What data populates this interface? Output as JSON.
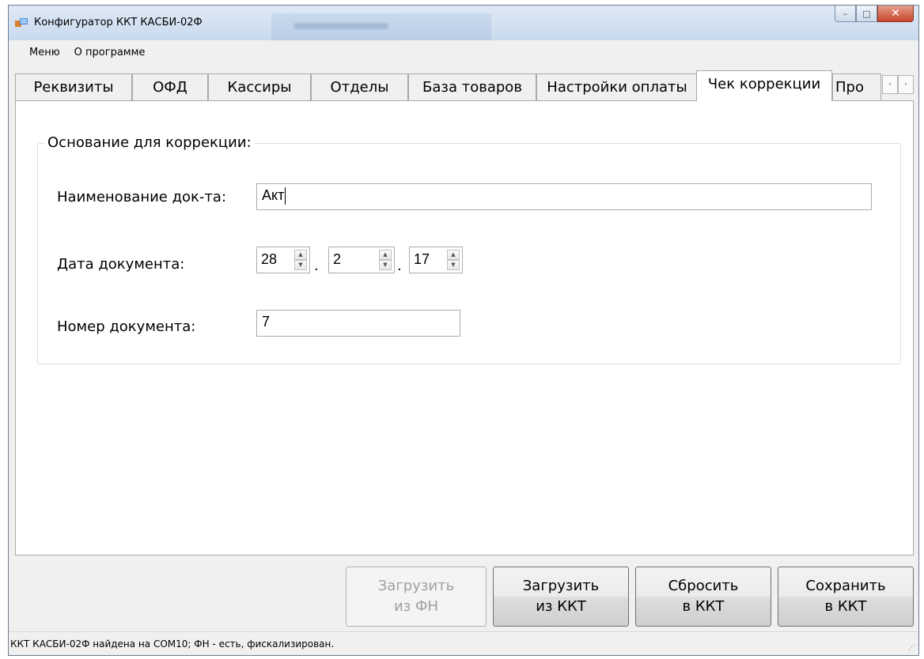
{
  "window": {
    "title": "Конфигуратор ККТ КАСБИ-02Ф",
    "controls": {
      "minimize": "–",
      "maximize": "□",
      "close": "✕"
    }
  },
  "menu": {
    "items": [
      "Меню",
      "О программе"
    ]
  },
  "tabs": {
    "items": [
      "Реквизиты",
      "ОФД",
      "Кассиры",
      "Отделы",
      "База товаров",
      "Настройки оплаты",
      "Чек коррекции",
      "Про"
    ],
    "active": "Чек коррекции",
    "scroll_left": "‹",
    "scroll_right": "›"
  },
  "form": {
    "group_label": "Основание для коррекции:",
    "doc_name": {
      "label": "Наименование док-та:",
      "value": "Акт"
    },
    "doc_date": {
      "label": "Дата документа:",
      "day": "28",
      "month": "2",
      "year": "17",
      "separator": "."
    },
    "doc_number": {
      "label": "Номер документа:",
      "value": "7"
    }
  },
  "buttons": {
    "load_fn": {
      "line1": "Загрузить",
      "line2": "из ФН",
      "enabled": false
    },
    "load_kkt": {
      "line1": "Загрузить",
      "line2": "из ККТ",
      "enabled": true
    },
    "reset_kkt": {
      "line1": "Сбросить",
      "line2": "в ККТ",
      "enabled": true
    },
    "save_kkt": {
      "line1": "Сохранить",
      "line2": "в ККТ",
      "enabled": true
    }
  },
  "status": {
    "text": "ККТ КАСБИ-02Ф найдена на COM10; ФН - есть, фискализирован."
  },
  "colors": {
    "titlebar": "#c9daee",
    "close_button": "#c7452b",
    "disabled_text": "#a0a0a0"
  }
}
